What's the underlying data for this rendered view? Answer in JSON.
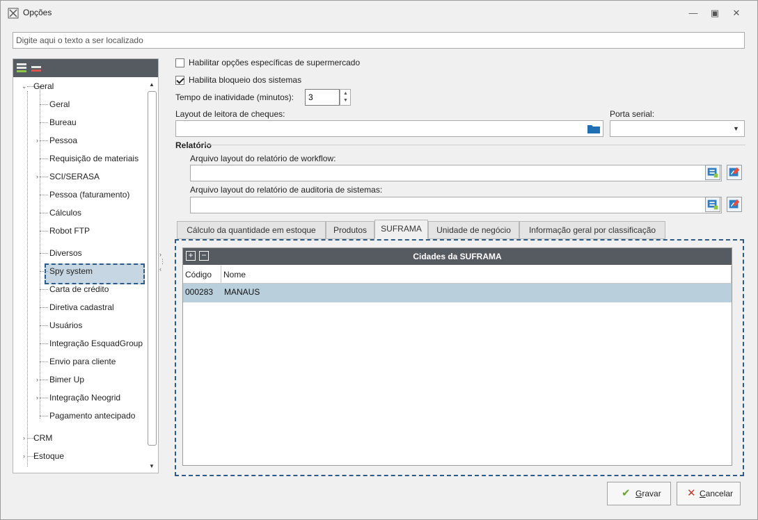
{
  "window": {
    "title": "Opções"
  },
  "search": {
    "placeholder": "Digite aqui o texto a ser localizado",
    "value": ""
  },
  "tree": {
    "items": [
      {
        "label": "Geral",
        "level": 0,
        "expanded": true
      },
      {
        "label": "Geral",
        "level": 1
      },
      {
        "label": "Bureau",
        "level": 1
      },
      {
        "label": "Pessoa",
        "level": 1,
        "collapsed": true
      },
      {
        "label": "Requisição de materiais",
        "level": 1
      },
      {
        "label": "SCI/SERASA",
        "level": 1,
        "collapsed": true
      },
      {
        "label": "Pessoa (faturamento)",
        "level": 1
      },
      {
        "label": "Cálculos",
        "level": 1
      },
      {
        "label": "Robot FTP",
        "level": 1
      },
      {
        "label": "Diversos",
        "level": 1,
        "selected": true
      },
      {
        "label": "Spy system",
        "level": 1
      },
      {
        "label": "Carta de crédito",
        "level": 1
      },
      {
        "label": "Diretiva cadastral",
        "level": 1
      },
      {
        "label": "Usuários",
        "level": 1
      },
      {
        "label": "Integração EsquadGroup",
        "level": 1
      },
      {
        "label": "Envio para cliente",
        "level": 1
      },
      {
        "label": "Bimer Up",
        "level": 1,
        "collapsed": true
      },
      {
        "label": "Integração Neogrid",
        "level": 1,
        "collapsed": true
      },
      {
        "label": "Pagamento antecipado",
        "level": 1
      },
      {
        "label": "CRM",
        "level": 0,
        "collapsed": true
      },
      {
        "label": "Estoque",
        "level": 0,
        "collapsed": true
      }
    ]
  },
  "form": {
    "supermarket_label": "Habilitar opções específicas de supermercado",
    "supermarket_checked": false,
    "lock_label": "Habilita bloqueio dos sistemas",
    "lock_checked": true,
    "inactivity_label": "Tempo de inatividade (minutos):",
    "inactivity_value": "3",
    "check_reader_label": "Layout de leitora de cheques:",
    "serial_port_label": "Porta serial:",
    "report_section_label": "Relatório",
    "workflow_label": "Arquivo layout do relatório de workflow:",
    "audit_label": "Arquivo layout do relatório de auditoria de sistemas:"
  },
  "tabs": [
    {
      "label": "Cálculo da quantidade em estoque",
      "active": false
    },
    {
      "label": "Produtos",
      "active": false
    },
    {
      "label": "SUFRAMA",
      "active": true
    },
    {
      "label": "Unidade de negócio",
      "active": false
    },
    {
      "label": "Informação geral por classificação",
      "active": false
    }
  ],
  "grid": {
    "title": "Cidades da SUFRAMA",
    "columns": [
      "Código",
      "Nome"
    ],
    "rows": [
      {
        "codigo": "000283",
        "nome": "MANAUS"
      }
    ]
  },
  "buttons": {
    "save_label": "Gravar",
    "cancel_label": "Cancelar"
  },
  "colors": {
    "accent_dashed": "#2b5a86",
    "header_dark": "#555b61",
    "selected_row": "#b9cfdc",
    "save_check": "#6aa532",
    "cancel_x": "#c0392b"
  }
}
